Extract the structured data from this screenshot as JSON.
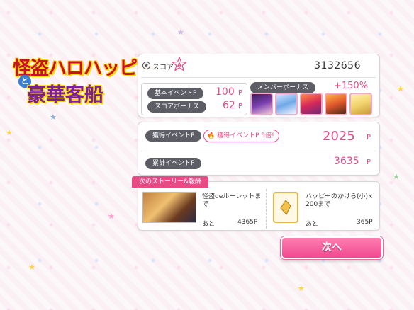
{
  "logo": {
    "line1": "怪盗ハロハッピー",
    "to": "と",
    "line2": "豪華客船"
  },
  "score": {
    "label": "スコア",
    "rank": "A",
    "value": "3132656"
  },
  "basic_event": {
    "label": "基本イベントP",
    "value": "100",
    "unit": "P"
  },
  "score_bonus": {
    "label": "スコアボーナス",
    "value": "62",
    "unit": "P"
  },
  "member_bonus": {
    "label": "メンバーボーナス",
    "value": "+150%"
  },
  "earned": {
    "label": "獲得イベントP",
    "multiplier_badge": "獲得イベントP 5倍!",
    "value": "2025",
    "unit": "P"
  },
  "total": {
    "label": "累計イベントP",
    "value": "3635",
    "unit": "P"
  },
  "next_rewards": {
    "tab": "次のストーリー&報酬",
    "story": {
      "title": "怪盗deルーレットまで",
      "remain_label": "あと",
      "remain": "4365P"
    },
    "item": {
      "title": "ハッピーのかけら(小)×\n200まで",
      "remain_label": "あと",
      "remain": "365P"
    }
  },
  "next_button": "次へ",
  "colors": {
    "accent": "#e84a86",
    "pill": "#5d5d66",
    "star": "#ffd24a"
  }
}
